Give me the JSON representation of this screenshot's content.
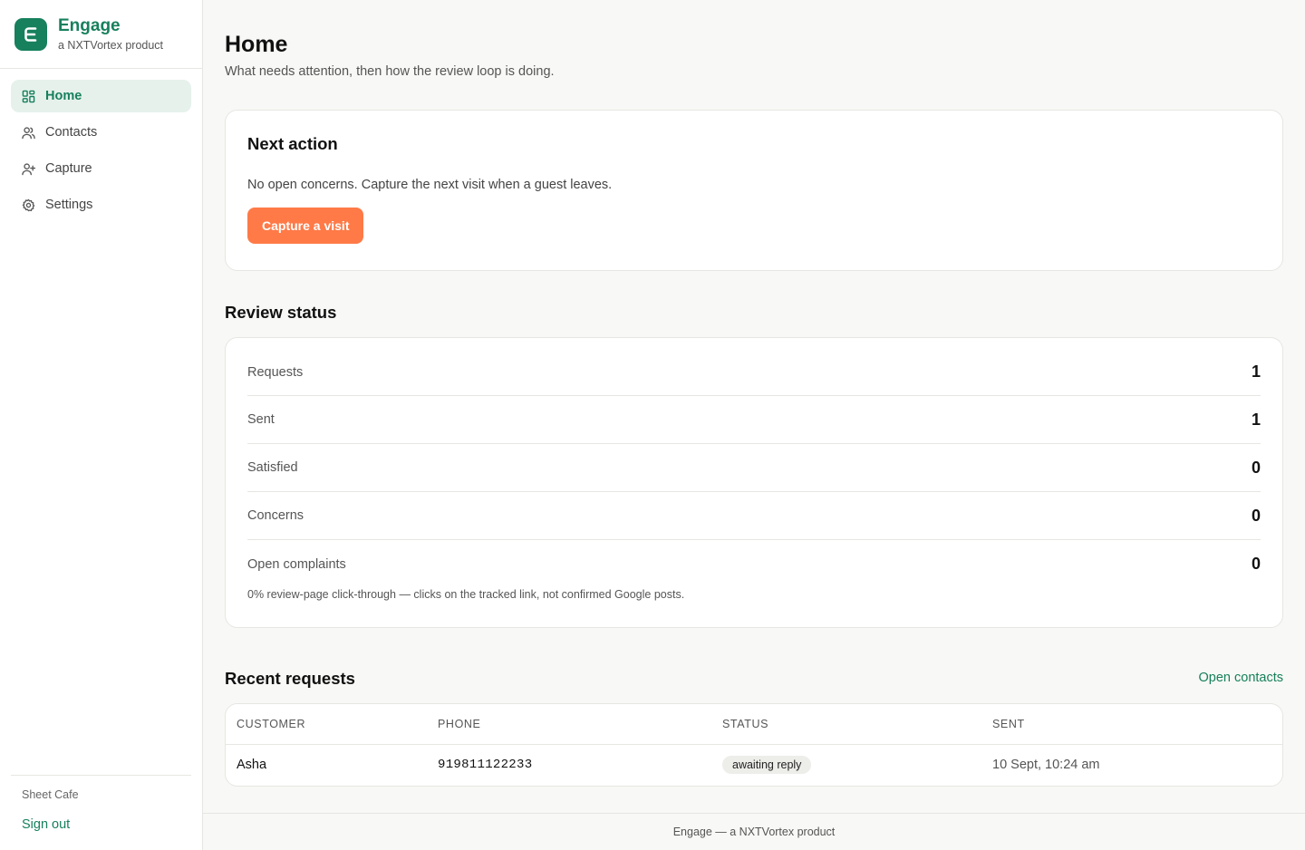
{
  "brand": {
    "name": "Engage",
    "tagline": "a NXTVortex product",
    "accent": "#17805c"
  },
  "sidebar": {
    "items": [
      {
        "label": "Home",
        "icon": "dashboard-icon",
        "active": true
      },
      {
        "label": "Contacts",
        "icon": "users-icon"
      },
      {
        "label": "Capture",
        "icon": "user-plus-icon"
      },
      {
        "label": "Settings",
        "icon": "gear-icon"
      }
    ],
    "workspace": "Sheet Cafe",
    "sign_out": "Sign out"
  },
  "page": {
    "title": "Home",
    "subtitle": "What needs attention, then how the review loop is doing."
  },
  "next_action": {
    "title": "Next action",
    "text": "No open concerns. Capture the next visit when a guest leaves.",
    "button": "Capture a visit",
    "button_color": "#ff7a47"
  },
  "review_status": {
    "title": "Review status",
    "stats": [
      {
        "label": "Requests",
        "value": "1"
      },
      {
        "label": "Sent",
        "value": "1"
      },
      {
        "label": "Satisfied",
        "value": "0"
      },
      {
        "label": "Concerns",
        "value": "0"
      },
      {
        "label": "Open complaints",
        "value": "0"
      }
    ],
    "note": "0% review-page click-through — clicks on the tracked link, not confirmed Google posts."
  },
  "recent_requests": {
    "title": "Recent requests",
    "link": "Open contacts",
    "columns": [
      "CUSTOMER",
      "PHONE",
      "STATUS",
      "SENT"
    ],
    "rows": [
      {
        "customer": "Asha",
        "phone": "919811122233",
        "status": "awaiting reply",
        "sent": "10 Sept, 10:24 am"
      }
    ]
  },
  "footer": {
    "text": "Engage — a NXTVortex product"
  }
}
